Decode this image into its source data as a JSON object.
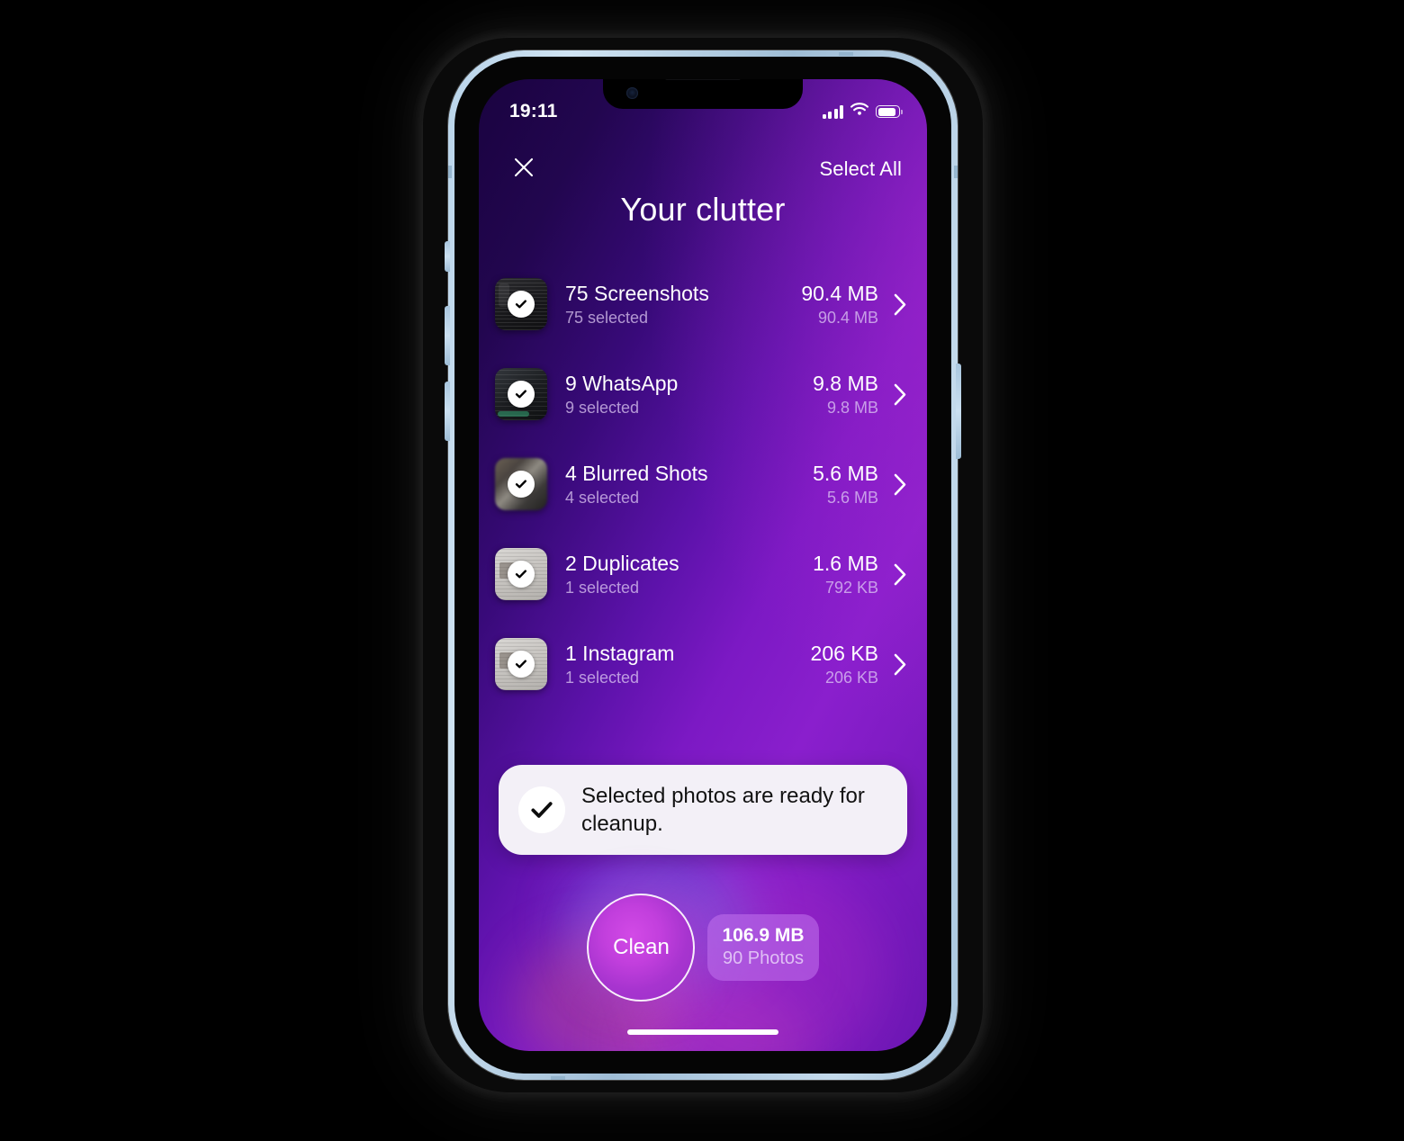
{
  "device": {
    "frame_color": "#b9d4ea",
    "status_bar": {
      "time": "19:11",
      "cellular_icon": "signal-bars-icon",
      "wifi_icon": "wifi-icon",
      "battery_icon": "battery-icon"
    },
    "home_indicator": "home-indicator"
  },
  "screen": {
    "background_from": "#1a0340",
    "background_to": "#8a1fcd",
    "nav": {
      "close_icon": "close-icon",
      "select_all_label": "Select All"
    },
    "title": "Your clutter",
    "list": [
      {
        "thumb_style": "dark",
        "thumb_name": "screenshot-thumbnail",
        "title": "75 Screenshots",
        "subtitle": "75 selected",
        "size": "90.4 MB",
        "size_sub": "90.4 MB",
        "selected": true,
        "chevron_icon": "chevron-right-icon"
      },
      {
        "thumb_style": "chat",
        "thumb_name": "whatsapp-thumbnail",
        "title": "9 WhatsApp",
        "subtitle": "9 selected",
        "size": "9.8 MB",
        "size_sub": "9.8 MB",
        "selected": true,
        "chevron_icon": "chevron-right-icon"
      },
      {
        "thumb_style": "blur",
        "thumb_name": "blurred-shot-thumbnail",
        "title": "4 Blurred Shots",
        "subtitle": "4 selected",
        "size": "5.6 MB",
        "size_sub": "5.6 MB",
        "selected": true,
        "chevron_icon": "chevron-right-icon"
      },
      {
        "thumb_style": "light",
        "thumb_name": "duplicate-thumbnail",
        "title": "2 Duplicates",
        "subtitle": "1 selected",
        "size": "1.6 MB",
        "size_sub": "792 KB",
        "selected": true,
        "chevron_icon": "chevron-right-icon"
      },
      {
        "thumb_style": "light",
        "thumb_name": "instagram-thumbnail",
        "title": "1 Instagram",
        "subtitle": "1 selected",
        "size": "206 KB",
        "size_sub": "206 KB",
        "selected": true,
        "chevron_icon": "chevron-right-icon"
      }
    ],
    "ready_card": {
      "check_icon": "check-icon",
      "message": "Selected photos are ready for cleanup."
    },
    "clean": {
      "button_label": "Clean",
      "total_size": "106.9 MB",
      "total_count": "90 Photos",
      "accent": "#c23fdd"
    }
  }
}
